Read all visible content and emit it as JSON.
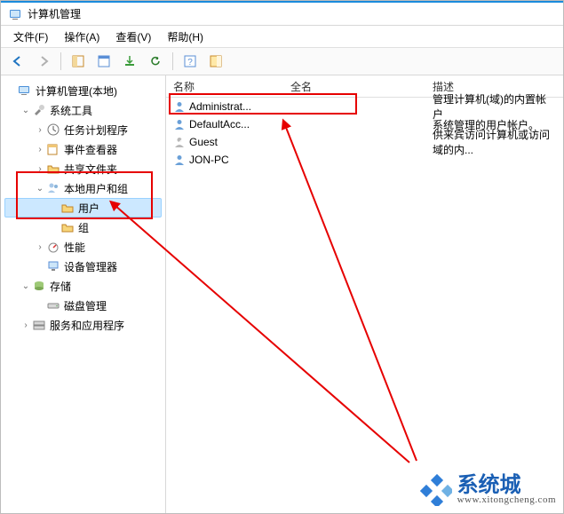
{
  "window": {
    "title": "计算机管理"
  },
  "menu": [
    {
      "id": "file",
      "label": "文件(F)"
    },
    {
      "id": "action",
      "label": "操作(A)"
    },
    {
      "id": "view",
      "label": "查看(V)"
    },
    {
      "id": "help",
      "label": "帮助(H)"
    }
  ],
  "tree": {
    "root": "计算机管理(本地)",
    "system_tools": "系统工具",
    "task_scheduler": "任务计划程序",
    "event_viewer": "事件查看器",
    "shared_folders": "共享文件夹",
    "local_users_groups": "本地用户和组",
    "users": "用户",
    "groups": "组",
    "performance": "性能",
    "device_manager": "设备管理器",
    "storage": "存储",
    "disk_management": "磁盘管理",
    "services_apps": "服务和应用程序"
  },
  "list": {
    "cols": {
      "name": "名称",
      "fullname": "全名",
      "desc": "描述"
    },
    "rows": [
      {
        "name": "Administrat...",
        "desc": "管理计算机(域)的内置帐户"
      },
      {
        "name": "DefaultAcc...",
        "desc": "系统管理的用户帐户。"
      },
      {
        "name": "Guest",
        "desc": "供来宾访问计算机或访问域的内..."
      },
      {
        "name": "JON-PC",
        "desc": ""
      }
    ]
  },
  "watermark": {
    "brand": "系统城",
    "url": "www.xitongcheng.com"
  }
}
